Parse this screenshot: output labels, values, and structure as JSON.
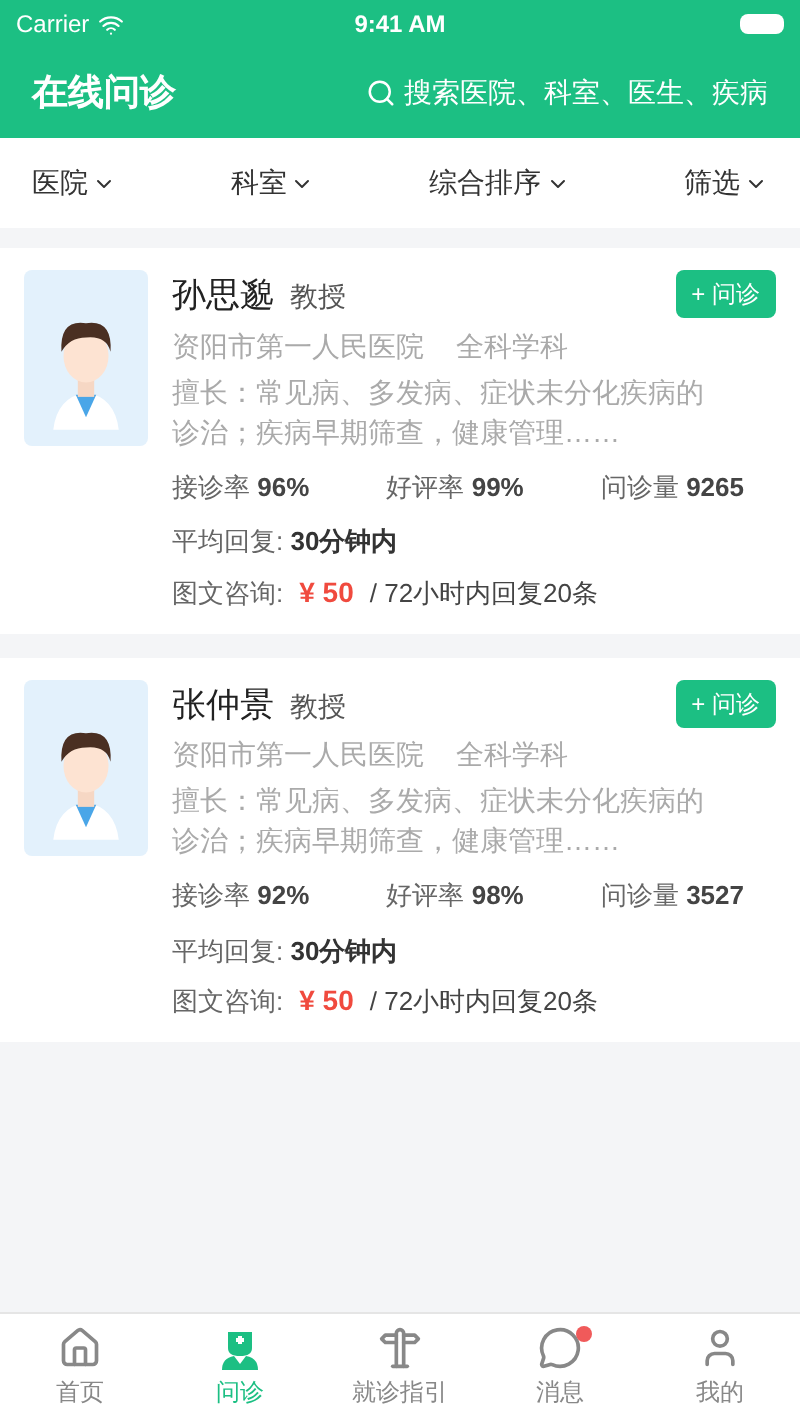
{
  "status_bar": {
    "carrier": "Carrier",
    "time": "9:41 AM"
  },
  "header": {
    "title": "在线问诊",
    "search": {
      "placeholder": "搜索医院、科室、医生、疾病"
    }
  },
  "filters": [
    {
      "label": "医院"
    },
    {
      "label": "科室"
    },
    {
      "label": "综合排序"
    },
    {
      "label": "筛选"
    }
  ],
  "doctors": [
    {
      "name": "孙思邈",
      "title": "教授",
      "hospital": "资阳市第一人民医院",
      "department": "全科学科",
      "specialty": "擅长：常见病、多发病、症状未分化疾病的诊治；疾病早期筛查，健康管理……",
      "stats": [
        {
          "label": "接诊率",
          "value": "96%"
        },
        {
          "label": "好评率",
          "value": "99%"
        },
        {
          "label": "问诊量",
          "value": "9265"
        }
      ],
      "reply_label": "平均回复:",
      "reply_value": "30分钟内",
      "consult_label": "图文咨询:",
      "price": "¥ 50",
      "price_note": "/ 72小时内回复20条",
      "button": "+ 问诊"
    },
    {
      "name": "张仲景",
      "title": "教授",
      "hospital": "资阳市第一人民医院",
      "department": "全科学科",
      "specialty": "擅长：常见病、多发病、症状未分化疾病的诊治；疾病早期筛查，健康管理……",
      "stats": [
        {
          "label": "接诊率",
          "value": "92%"
        },
        {
          "label": "好评率",
          "value": "98%"
        },
        {
          "label": "问诊量",
          "value": "3527"
        }
      ],
      "reply_label": "平均回复:",
      "reply_value": "30分钟内",
      "consult_label": "图文咨询:",
      "price": "¥ 50",
      "price_note": "/ 72小时内回复20条",
      "button": "+ 问诊"
    }
  ],
  "tab_bar": [
    {
      "kind": "home",
      "label": "首页",
      "selected": false,
      "badge": false
    },
    {
      "kind": "doctor",
      "label": "问诊",
      "selected": true,
      "badge": false
    },
    {
      "kind": "guide",
      "label": "就诊指引",
      "selected": false,
      "badge": false
    },
    {
      "kind": "message",
      "label": "消息",
      "selected": false,
      "badge": true
    },
    {
      "kind": "user",
      "label": "我的",
      "selected": false,
      "badge": false
    }
  ]
}
